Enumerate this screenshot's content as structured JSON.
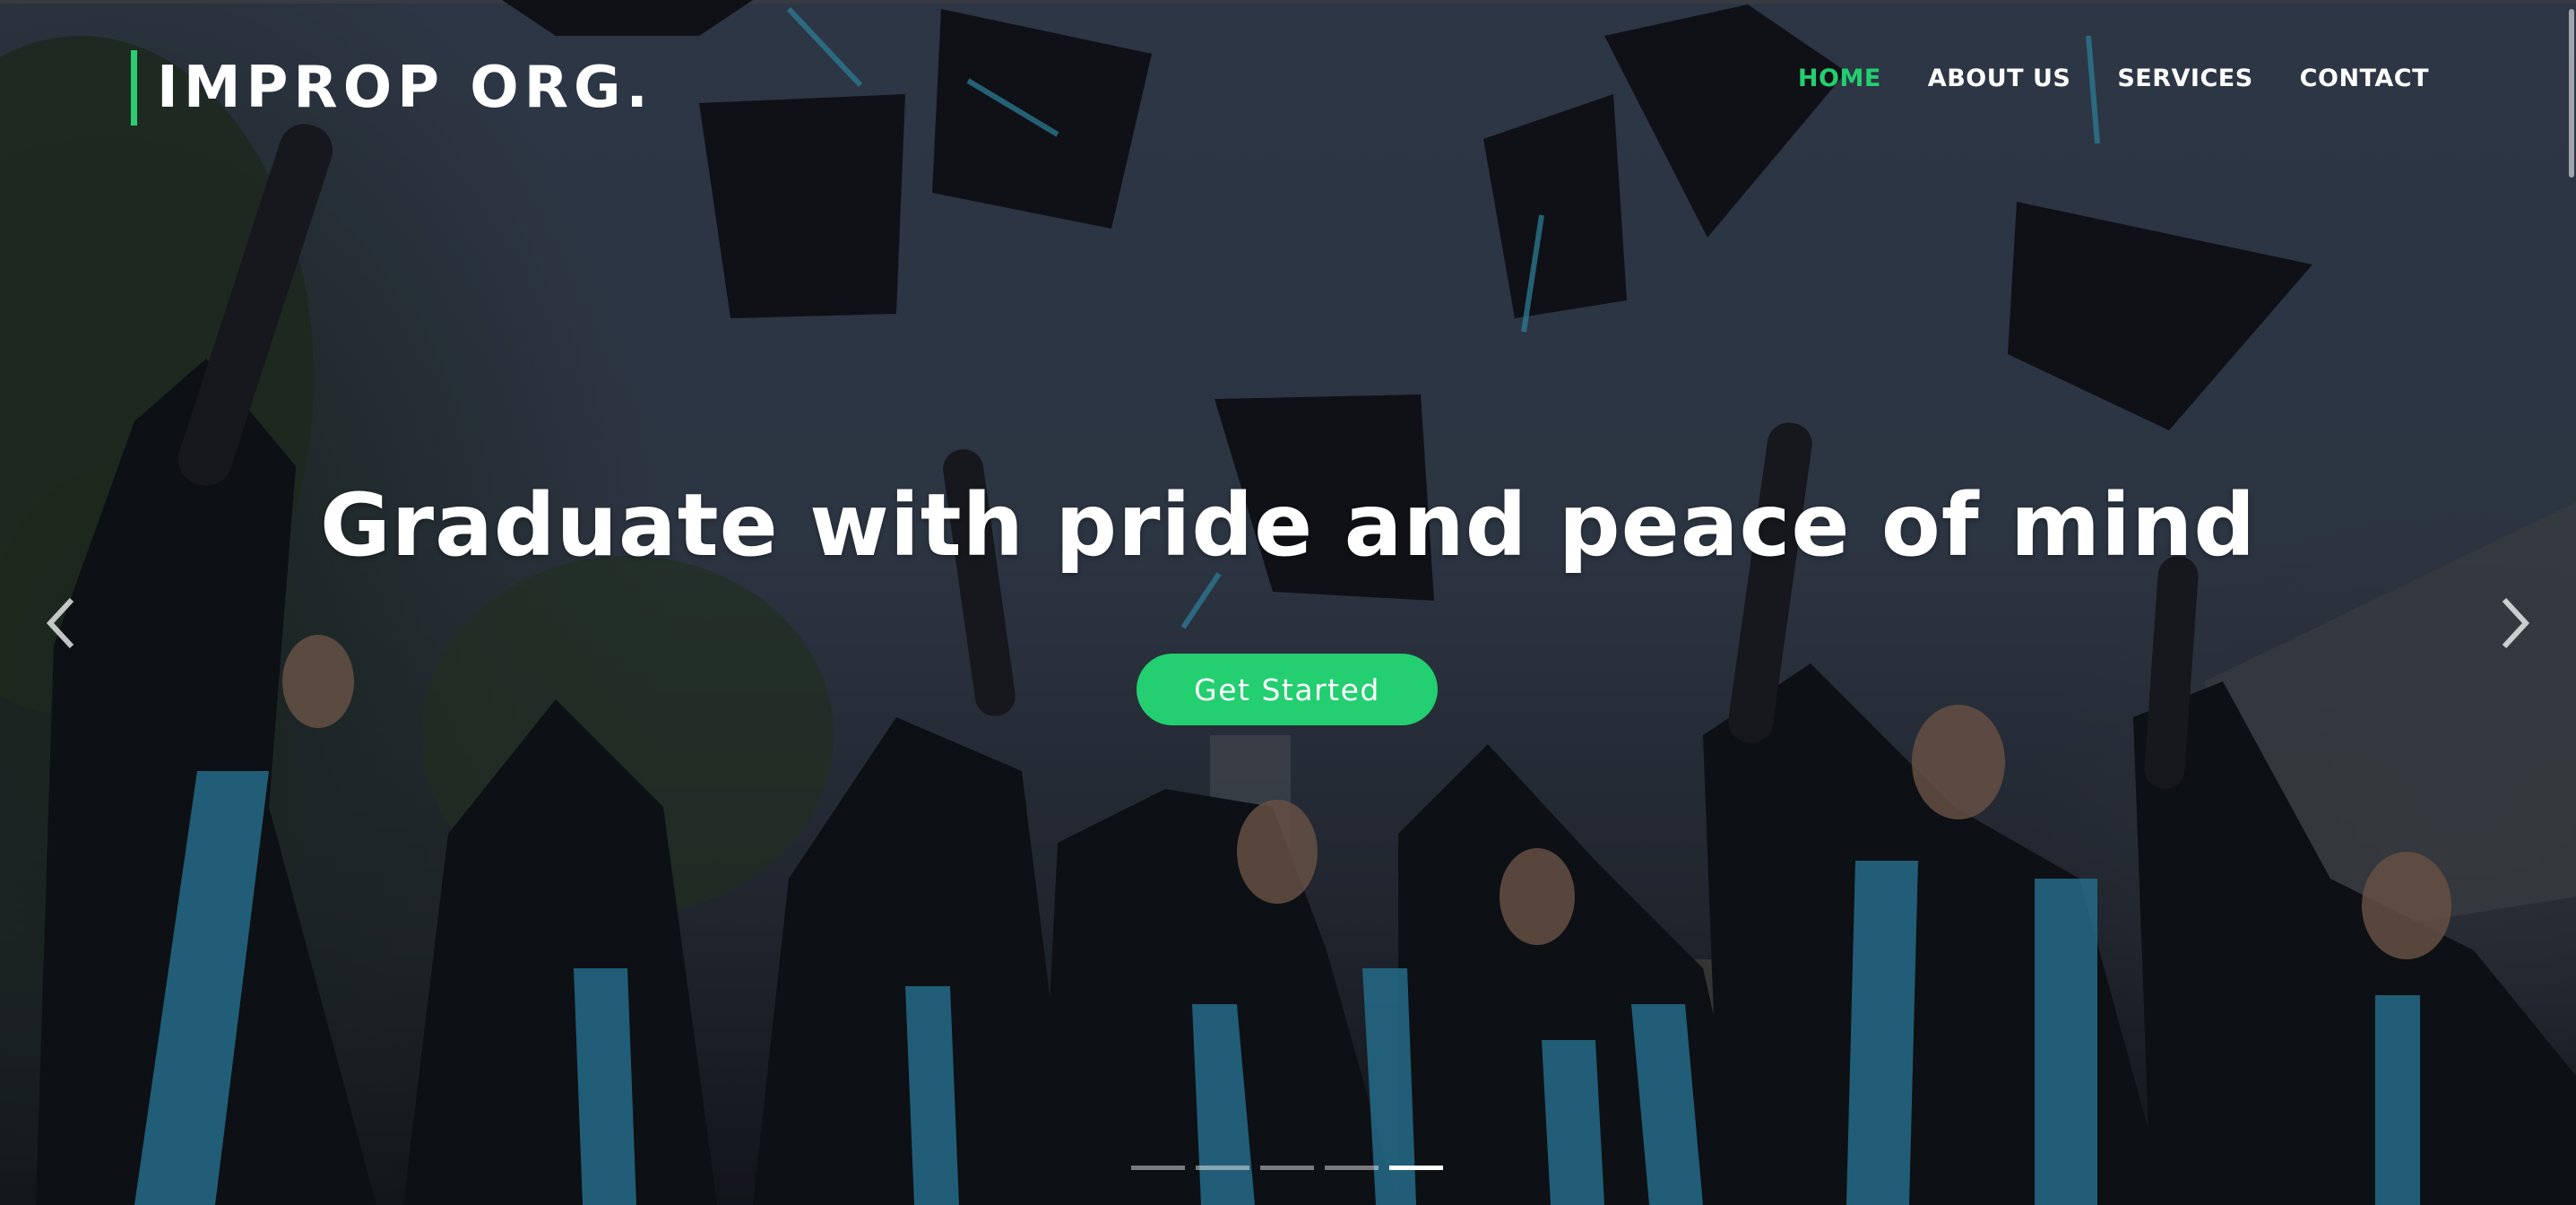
{
  "brand": {
    "logo_text": "IMPROP ORG.",
    "accent_color": "#23cf70"
  },
  "nav": {
    "items": [
      {
        "label": "HOME",
        "active": true
      },
      {
        "label": "ABOUT US",
        "active": false
      },
      {
        "label": "SERVICES",
        "active": false
      },
      {
        "label": "CONTACT",
        "active": false
      }
    ]
  },
  "hero": {
    "headline": "Graduate with pride and peace of mind",
    "cta_label": "Get Started",
    "background": "graduates throwing caps",
    "prev_icon": "chevron-left-icon",
    "next_icon": "chevron-right-icon"
  },
  "carousel": {
    "slide_count": 5,
    "active_index": 4
  }
}
